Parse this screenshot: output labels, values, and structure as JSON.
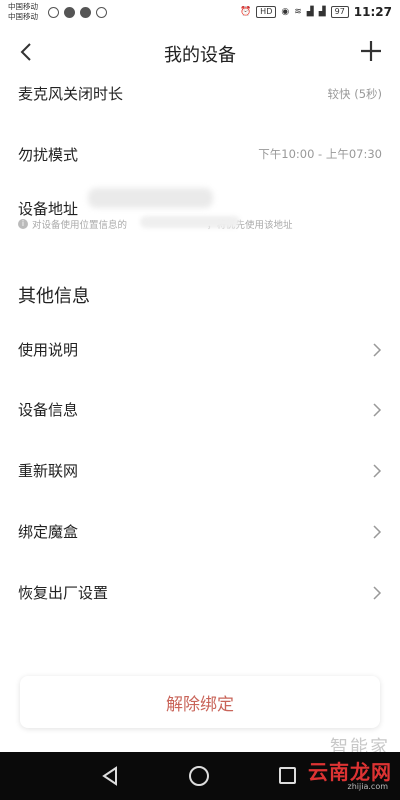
{
  "status_bar": {
    "carrier_1": "中国移动",
    "carrier_2": "中国移动",
    "battery": "97",
    "time": "11:27",
    "hd_badge": "HD"
  },
  "nav": {
    "title": "我的设备"
  },
  "settings": {
    "mic_off": {
      "label": "麦克风关闭时长",
      "value": "较快 (5秒)"
    },
    "dnd": {
      "label": "勿扰模式",
      "value": "下午10:00 - 上午07:30"
    },
    "address": {
      "label": "设备地址",
      "hint_start": "对设备使用位置信息的",
      "hint_end": "，将优先使用该地址"
    }
  },
  "other_info": {
    "title": "其他信息",
    "items": [
      {
        "label": "使用说明"
      },
      {
        "label": "设备信息"
      },
      {
        "label": "重新联网"
      },
      {
        "label": "绑定魔盒"
      },
      {
        "label": "恢复出厂设置"
      }
    ]
  },
  "unbind_label": "解除绑定",
  "watermark": {
    "brand": "云南龙网",
    "sub": "zhijia.com",
    "faded": "智能家"
  }
}
